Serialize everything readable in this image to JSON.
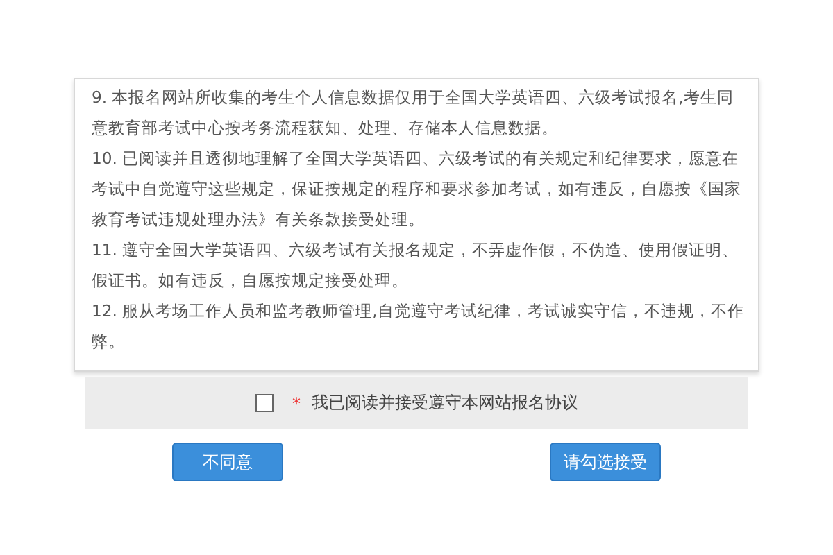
{
  "agreement": {
    "paragraphs": [
      "9. 本报名网站所收集的考生个人信息数据仅用于全国大学英语四、六级考试报名,考生同意教育部考试中心按考务流程获知、处理、存储本人信息数据。",
      "10. 已阅读并且透彻地理解了全国大学英语四、六级考试的有关规定和纪律要求，愿意在考试中自觉遵守这些规定，保证按规定的程序和要求参加考试，如有违反，自愿按《国家教育考试违规处理办法》有关条款接受处理。",
      "11. 遵守全国大学英语四、六级考试有关报名规定，不弄虚作假，不伪造、使用假证明、假证书。如有违反，自愿按规定接受处理。",
      "12. 服从考场工作人员和监考教师管理,自觉遵守考试纪律，考试诚实守信，不违规，不作弊。"
    ]
  },
  "consent": {
    "checked": false,
    "required_mark": "*",
    "label": "我已阅读并接受遵守本网站报名协议"
  },
  "buttons": [
    {
      "label": "不同意"
    },
    {
      "label": "请勾选接受"
    }
  ]
}
